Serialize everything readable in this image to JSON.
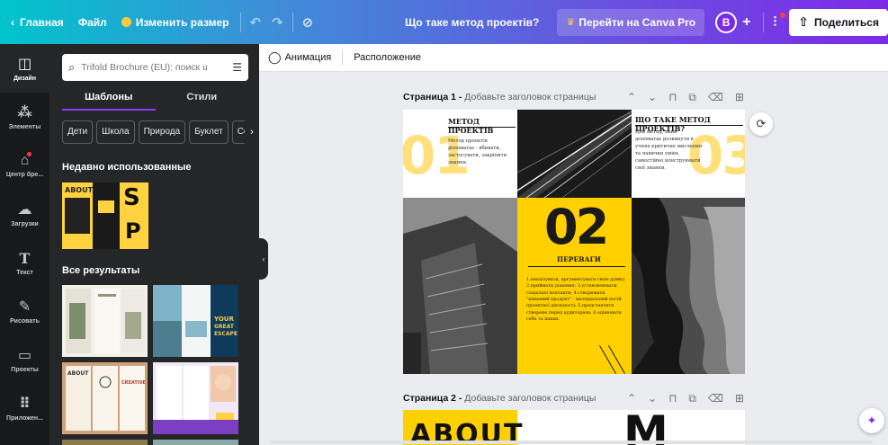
{
  "topbar": {
    "back_label": "Главная",
    "file_label": "Файл",
    "resize_label": "Изменить размер",
    "project_title": "Що таке метод проектів?",
    "pro_label": "Перейти на Canva Pro",
    "avatar_letter": "B",
    "share_label": "Поделиться"
  },
  "rail": {
    "items": [
      {
        "label": "Дизайн",
        "icon": "layout-icon"
      },
      {
        "label": "Элементы",
        "icon": "shapes-icon"
      },
      {
        "label": "Центр бре...",
        "icon": "brand-kit-icon"
      },
      {
        "label": "Загрузки",
        "icon": "cloud-upload-icon"
      },
      {
        "label": "Текст",
        "icon": "text-icon"
      },
      {
        "label": "Рисовать",
        "icon": "draw-icon"
      },
      {
        "label": "Проекты",
        "icon": "folder-icon"
      },
      {
        "label": "Приложен...",
        "icon": "apps-icon"
      }
    ]
  },
  "panel": {
    "search_placeholder": "Trifold Brochure (EU): поиск шабл",
    "tabs": [
      "Шаблоны",
      "Стили"
    ],
    "chips": [
      "Дети",
      "Школа",
      "Природа",
      "Буклет",
      "Со"
    ],
    "recent_heading": "Недавно использованные",
    "results_heading": "Все результаты",
    "recent_thumb_text": "ABOUT"
  },
  "context_toolbar": {
    "animation_label": "Анимация",
    "position_label": "Расположение"
  },
  "canvas": {
    "page1": {
      "label_bold": "Страница 1 - ",
      "label_sub": "Добавьте заголовок страницы",
      "num1": "01",
      "heading1": "МЕТОД ПРОЕКТІВ",
      "body1": "Метод проектів допомагає - вбивати, застосувати, закріпити знання.",
      "num3": "03",
      "heading3": "ЩО ТАКЕ МЕТОД ПРОЕКТІВ?",
      "body3": "Цей метод, який допомагає розвинути в учнях критичне мислення та навички умінь самостійно конструювати свої знання.",
      "num2": "02",
      "heading2": "ПЕРЕВАГИ",
      "body2": "1.аналізувати, аргументувати свою думку; 2.приймати рішення; 3.установлювати соціальні контакти; 4.створювати \"кінцевий продукт\" - матеріальний носій проектної діяльності; 5.представляти створене перед аудиторією; 6.оцінювати себе та інших."
    },
    "page2": {
      "label_bold": "Страница 2 - ",
      "label_sub": "Добавьте заголовок страницы",
      "about_text": "ABOUT",
      "letter": "M"
    }
  },
  "colors": {
    "accent_purple": "#8b3dff",
    "brochure_yellow": "#ffd000",
    "panel_bg": "#252627",
    "rail_bg": "#18191b"
  }
}
